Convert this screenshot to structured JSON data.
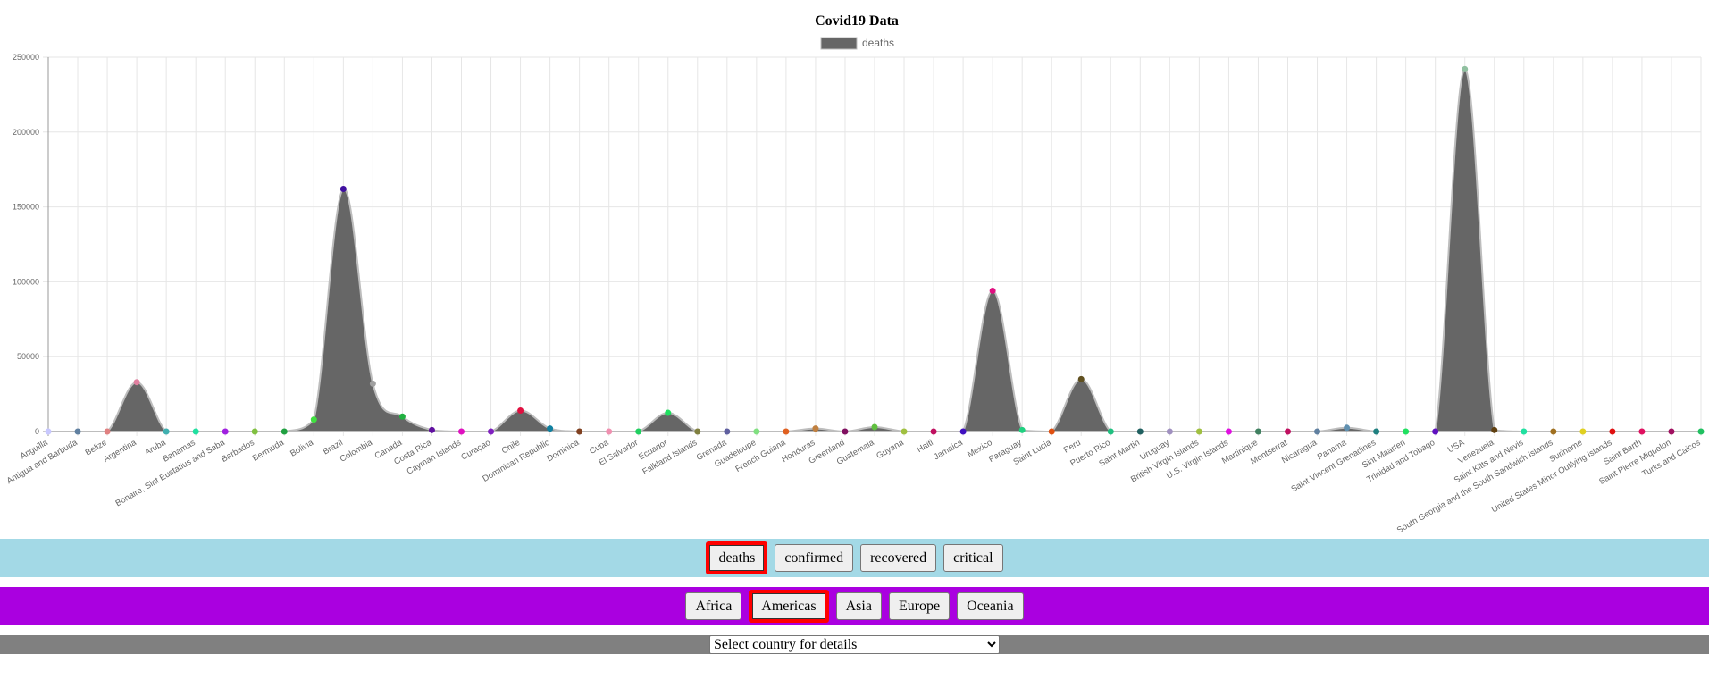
{
  "chart_data": {
    "type": "line",
    "title": "Covid19 Data",
    "legend": [
      "deaths"
    ],
    "legend_position": "top",
    "series": [
      {
        "name": "deaths",
        "fill_color": "#666666"
      }
    ],
    "ylim": [
      0,
      250000
    ],
    "y_ticks": [
      "0",
      "50000",
      "100000",
      "150000",
      "200000",
      "250000"
    ],
    "y_tick_values": [
      0,
      50000,
      100000,
      150000,
      200000,
      250000
    ],
    "grid": true,
    "categories": [
      "Anguilla",
      "Antigua and Barbuda",
      "Belize",
      "Argentina",
      "Aruba",
      "Bahamas",
      "Bonaire, Sint Eustatius and Saba",
      "Barbados",
      "Bermuda",
      "Bolivia",
      "Brazil",
      "Colombia",
      "Canada",
      "Costa Rica",
      "Cayman Islands",
      "Curaçao",
      "Chile",
      "Dominican Republic",
      "Dominica",
      "Cuba",
      "El Salvador",
      "Ecuador",
      "Falkland Islands",
      "Grenada",
      "Guadeloupe",
      "French Guiana",
      "Honduras",
      "Greenland",
      "Guatemala",
      "Guyana",
      "Haiti",
      "Jamaica",
      "Mexico",
      "Paraguay",
      "Saint Lucia",
      "Peru",
      "Puerto Rico",
      "Saint Martin",
      "Uruguay",
      "British Virgin Islands",
      "U.S. Virgin Islands",
      "Martinique",
      "Montserrat",
      "Nicaragua",
      "Panama",
      "Saint Vincent Grenadines",
      "Sint Maarten",
      "Trinidad and Tobago",
      "USA",
      "Venezuela",
      "Saint Kitts and Nevis",
      "South Georgia and the South Sandwich Islands",
      "Suriname",
      "United States Minor Outlying Islands",
      "Saint Barth",
      "Saint Pierre Miquelon",
      "Turks and Caicos"
    ],
    "values": [
      0,
      0,
      0,
      33000,
      0,
      0,
      0,
      0,
      0,
      8000,
      162000,
      32000,
      10000,
      1000,
      0,
      0,
      14000,
      2000,
      0,
      0,
      0,
      12500,
      0,
      0,
      0,
      0,
      2000,
      0,
      3000,
      0,
      0,
      0,
      94000,
      1000,
      0,
      35000,
      0,
      0,
      0,
      0,
      0,
      0,
      0,
      0,
      2500,
      0,
      0,
      0,
      242000,
      1000,
      0,
      0,
      0,
      0,
      0,
      0,
      0
    ],
    "point_colors": [
      "#c8c8ff",
      "#6080a0",
      "#e08080",
      "#e080a0",
      "#40b0b0",
      "#20e0a0",
      "#a020e0",
      "#80c040",
      "#20a040",
      "#40e040",
      "#4010a0",
      "#a0a0a0",
      "#20b040",
      "#6010a0",
      "#e010c0",
      "#8020c0",
      "#e01040",
      "#1080a0",
      "#804020",
      "#f090b0",
      "#20d060",
      "#20e060",
      "#808040",
      "#6060a0",
      "#80e080",
      "#e06020",
      "#c08040",
      "#801060",
      "#60c040",
      "#a0c040",
      "#c01060",
      "#4010c0",
      "#e01080",
      "#20d080",
      "#e05010",
      "#605020",
      "#20c080",
      "#206060",
      "#a090c0",
      "#a0c040",
      "#e010e0",
      "#408060",
      "#c01060",
      "#6080a0",
      "#6090b0",
      "#208080",
      "#20e060",
      "#6010c0",
      "#90c0a0",
      "#604010",
      "#20e0a0",
      "#a07020",
      "#e0d020",
      "#e01010",
      "#e01060",
      "#a01060",
      "#20c060"
    ]
  },
  "buttons": {
    "metrics": [
      "deaths",
      "confirmed",
      "recovered",
      "critical"
    ],
    "regions": [
      "Africa",
      "Americas",
      "Asia",
      "Europe",
      "Oceania"
    ]
  },
  "select": {
    "label": "Select country for details"
  }
}
